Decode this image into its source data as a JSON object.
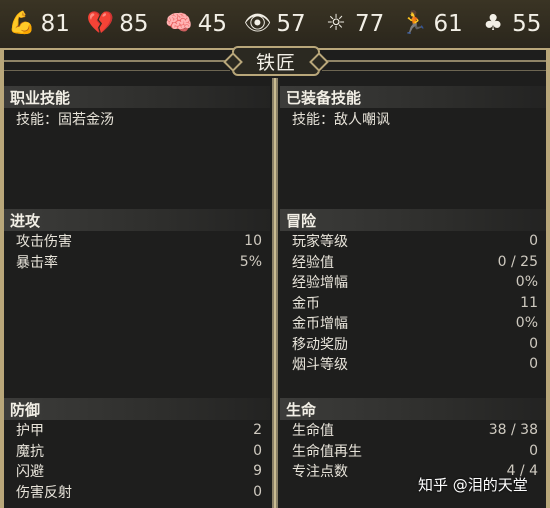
{
  "stats": [
    {
      "icon": "strength-arm-icon",
      "glyph": "💪",
      "value": "81"
    },
    {
      "icon": "broken-heart-icon",
      "glyph": "💔",
      "value": "85"
    },
    {
      "icon": "brain-icon",
      "glyph": "🧠",
      "value": "45"
    },
    {
      "icon": "eye-icon",
      "glyph": "👁",
      "value": "57"
    },
    {
      "icon": "sun-figure-icon",
      "glyph": "☼",
      "value": "77"
    },
    {
      "icon": "running-figure-icon",
      "glyph": "🏃",
      "value": "61"
    },
    {
      "icon": "clover-icon",
      "glyph": "♣",
      "value": "55"
    }
  ],
  "title": "铁匠",
  "left": {
    "job_skill": {
      "header": "职业技能",
      "text": "技能：固若金汤"
    },
    "attack": {
      "header": "进攻",
      "rows": [
        {
          "label": "攻击伤害",
          "value": "10"
        },
        {
          "label": "暴击率",
          "value": "5%"
        }
      ]
    },
    "defense": {
      "header": "防御",
      "rows": [
        {
          "label": "护甲",
          "value": "2"
        },
        {
          "label": "魔抗",
          "value": "0"
        },
        {
          "label": "闪避",
          "value": "9"
        },
        {
          "label": "伤害反射",
          "value": "0"
        }
      ]
    }
  },
  "right": {
    "equipped_skill": {
      "header": "已装备技能",
      "text": "技能：敌人嘲讽"
    },
    "adventure": {
      "header": "冒险",
      "rows": [
        {
          "label": "玩家等级",
          "value": "0"
        },
        {
          "label": "经验值",
          "value": "0 / 25"
        },
        {
          "label": "经验增幅",
          "value": "0%"
        },
        {
          "label": "金币",
          "value": "11"
        },
        {
          "label": "金币增幅",
          "value": "0%"
        },
        {
          "label": "移动奖励",
          "value": "0"
        },
        {
          "label": "烟斗等级",
          "value": "0"
        }
      ]
    },
    "life": {
      "header": "生命",
      "rows": [
        {
          "label": "生命值",
          "value": "38 / 38"
        },
        {
          "label": "生命值再生",
          "value": "0"
        },
        {
          "label": "专注点数",
          "value": "4 / 4"
        }
      ]
    }
  },
  "watermark": "知乎 @泪的天堂",
  "colors": {
    "gold": "#b9a77a",
    "bg": "#1e1e1d",
    "header": "#3c3c3a"
  }
}
